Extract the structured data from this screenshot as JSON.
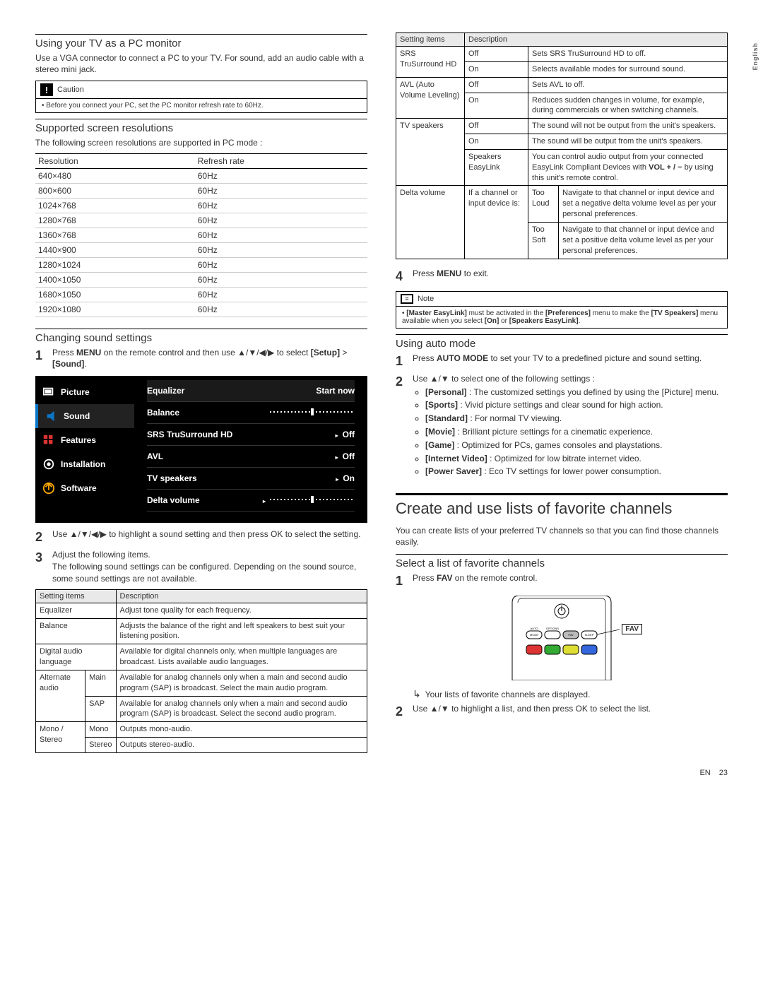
{
  "sideTab": "English",
  "leftCol": {
    "pcMonitor": {
      "heading": "Using your TV as a PC monitor",
      "intro": "Use a VGA connector to connect a PC to your TV. For sound, add an audio cable with a stereo mini jack.",
      "cautionLabel": "Caution",
      "cautionBody": "Before you connect your PC, set the PC monitor refresh rate to 60Hz."
    },
    "resolutions": {
      "heading": "Supported screen resolutions",
      "intro": "The following screen resolutions are supported in PC mode :",
      "th1": "Resolution",
      "th2": "Refresh rate",
      "rows": [
        {
          "r": "640×480",
          "hz": "60Hz"
        },
        {
          "r": "800×600",
          "hz": "60Hz"
        },
        {
          "r": "1024×768",
          "hz": "60Hz"
        },
        {
          "r": "1280×768",
          "hz": "60Hz"
        },
        {
          "r": "1360×768",
          "hz": "60Hz"
        },
        {
          "r": "1440×900",
          "hz": "60Hz"
        },
        {
          "r": "1280×1024",
          "hz": "60Hz"
        },
        {
          "r": "1400×1050",
          "hz": "60Hz"
        },
        {
          "r": "1680×1050",
          "hz": "60Hz"
        },
        {
          "r": "1920×1080",
          "hz": "60Hz"
        }
      ]
    },
    "sound": {
      "heading": "Changing sound settings",
      "step1a": "Press ",
      "step1menu": "MENU",
      "step1b": " on the remote control and then use ▲/▼/◀/▶ to select ",
      "step1setup": "[Setup]",
      "step1gt": " > ",
      "step1sound": "[Sound]",
      "step1dot": ".",
      "osd": {
        "menu": [
          {
            "label": "Picture"
          },
          {
            "label": "Sound"
          },
          {
            "label": "Features"
          },
          {
            "label": "Installation"
          },
          {
            "label": "Software"
          }
        ],
        "rows": [
          {
            "name": "Equalizer",
            "val": "Start now",
            "sel": true
          },
          {
            "name": "Balance",
            "val": "__slider__"
          },
          {
            "name": "SRS TruSurround HD",
            "val": "Off",
            "caret": true
          },
          {
            "name": "AVL",
            "val": "Off",
            "caret": true
          },
          {
            "name": "TV speakers",
            "val": "On",
            "caret": true
          },
          {
            "name": "Delta volume",
            "val": "__slider__",
            "caret": true
          }
        ]
      },
      "step2": "Use ▲/▼/◀/▶ to highlight a sound setting and then press OK to select the setting.",
      "step3a": "Adjust the following items.",
      "step3b": "The following sound settings can be configured. Depending on the sound source, some sound settings are not available.",
      "table1": {
        "h1": "Setting items",
        "h2": "Description",
        "rows": [
          {
            "c1": "Equalizer",
            "desc": "Adjust tone quality for each frequency."
          },
          {
            "c1": "Balance",
            "desc": "Adjusts the balance of the right and left speakers to best suit your listening position."
          },
          {
            "c1": "Digital audio language",
            "desc": "Available for digital channels only, when multiple languages are broadcast. Lists available audio languages."
          },
          {
            "c1": "Alternate audio",
            "c2": "Main",
            "desc": "Available for analog channels only when a main and second audio program (SAP) is broadcast. Select the main audio program."
          },
          {
            "c1": "",
            "c2": "SAP",
            "desc": "Available for analog channels only when a main and second audio program (SAP) is broadcast. Select the second audio program."
          },
          {
            "c1": "Mono / Stereo",
            "c2": "Mono",
            "desc": "Outputs mono-audio."
          },
          {
            "c1": "",
            "c2": "Stereo",
            "desc": "Outputs stereo-audio."
          }
        ]
      }
    }
  },
  "rightCol": {
    "table2": {
      "h1": "Setting items",
      "h2": "Description",
      "srs": {
        "name": "SRS TruSurround HD",
        "offDesc": "Sets SRS TruSurround HD to off.",
        "onDesc": "Selects available modes for surround sound."
      },
      "avl": {
        "name": "AVL (Auto Volume Leveling)",
        "offDesc": "Sets AVL to off.",
        "onDesc": "Reduces sudden changes in volume, for example, during commercials or when switching channels."
      },
      "tvsp": {
        "name": "TV speakers",
        "offDesc": "The sound will not be output from the unit's speakers.",
        "onDesc": "The sound will be output from the unit's speakers.",
        "easyLabel": "Speakers EasyLink",
        "easyDesc": "You can control audio output from your connected EasyLink Compliant Devices with VOL + / − by using this unit's remote control."
      },
      "delta": {
        "name": "Delta volume",
        "mid": "If a channel or input device is:",
        "loudLabel": "Too Loud",
        "loudDesc": "Navigate to that channel or input device and set a negative delta volume level as per your personal preferences.",
        "softLabel": "Too Soft",
        "softDesc": "Navigate to that channel or input device and set a positive delta volume level as per your personal preferences."
      },
      "off": "Off",
      "on": "On"
    },
    "step4": "Press MENU to exit.",
    "step4menu": "MENU",
    "step4pre": "Press ",
    "step4post": " to exit.",
    "noteLabel": "Note",
    "noteBody1": "[Master EasyLink]",
    "noteBody2": " must be activated in the ",
    "noteBody3": "[Preferences]",
    "noteBody4": " menu to make the ",
    "noteBody5": "[TV Speakers]",
    "noteBody6": " menu available when you select ",
    "noteBody7": "[On]",
    "noteBody8": " or ",
    "noteBody9": "[Speakers EasyLink]",
    "noteBody10": ".",
    "autoMode": {
      "heading": "Using auto mode",
      "step1pre": "Press ",
      "step1btn": "AUTO MODE",
      "step1post": " to set your TV to a predefined picture and sound setting.",
      "step2": "Use ▲/▼ to select one of the following settings :",
      "opts": [
        {
          "k": "[Personal]",
          "d": " : The customized settings you defined by using the [Picture] menu."
        },
        {
          "k": "[Sports]",
          "d": " : Vivid picture settings and clear sound for high action."
        },
        {
          "k": "[Standard]",
          "d": " : For normal TV viewing."
        },
        {
          "k": "[Movie]",
          "d": " : Brilliant picture settings for a cinematic experience."
        },
        {
          "k": "[Game]",
          "d": " : Optimized for PCs, games consoles and playstations."
        },
        {
          "k": "[Internet Video]",
          "d": " : Optimized for low bitrate internet video."
        },
        {
          "k": "[Power Saver]",
          "d": " : Eco TV settings for lower power consumption."
        }
      ]
    },
    "fav": {
      "title": "Create and use lists of favorite channels",
      "intro": "You can create lists of your preferred TV channels so that you can find those channels easily.",
      "subHeading": "Select a list of favorite channels",
      "step1pre": "Press ",
      "step1btn": "FAV",
      "step1post": " on the remote control.",
      "favLabel": "FAV",
      "autoMode": "AUTO MODE",
      "options": "OPTIONS",
      "favSmall": "FAV",
      "sleep": "SLEEP",
      "result": "Your lists of favorite channels are displayed.",
      "step2": "Use ▲/▼ to highlight a list, and then press OK to select the list."
    }
  },
  "footer": {
    "lang": "EN",
    "page": "23"
  }
}
